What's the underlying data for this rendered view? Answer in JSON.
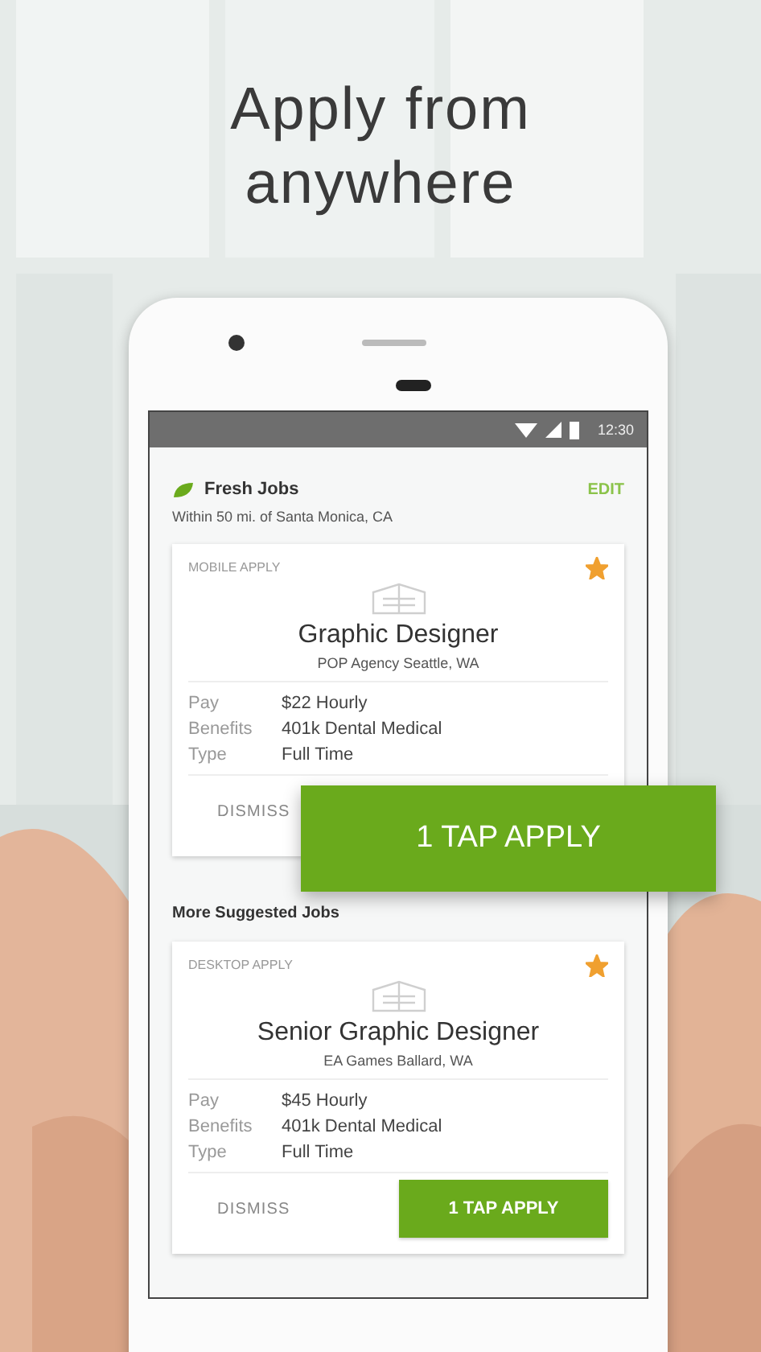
{
  "headline": "Apply from anywhere",
  "status_bar": {
    "time": "12:30"
  },
  "fresh_jobs": {
    "title": "Fresh Jobs",
    "subtitle": "Within 50 mi. of Santa Monica, CA",
    "edit": "EDIT",
    "jobs": [
      {
        "apply_type": "MOBILE APPLY",
        "starred": true,
        "title": "Graphic Designer",
        "company": "POP Agency Seattle, WA",
        "details": [
          {
            "label": "Pay",
            "value": "$22 Hourly"
          },
          {
            "label": "Benefits",
            "value": "401k Dental Medical"
          },
          {
            "label": "Type",
            "value": "Full Time"
          }
        ],
        "dismiss": "DISMISS"
      }
    ]
  },
  "suggested": {
    "title": "More Suggested Jobs",
    "jobs": [
      {
        "apply_type": "DESKTOP APPLY",
        "starred": true,
        "title": "Senior Graphic Designer",
        "company": "EA Games Ballard, WA",
        "details": [
          {
            "label": "Pay",
            "value": "$45 Hourly"
          },
          {
            "label": "Benefits",
            "value": "401k Dental Medical"
          },
          {
            "label": "Type",
            "value": "Full Time"
          }
        ],
        "dismiss": "DISMISS",
        "apply": "1 TAP APPLY"
      }
    ]
  },
  "overlay_button": "1 TAP APPLY"
}
